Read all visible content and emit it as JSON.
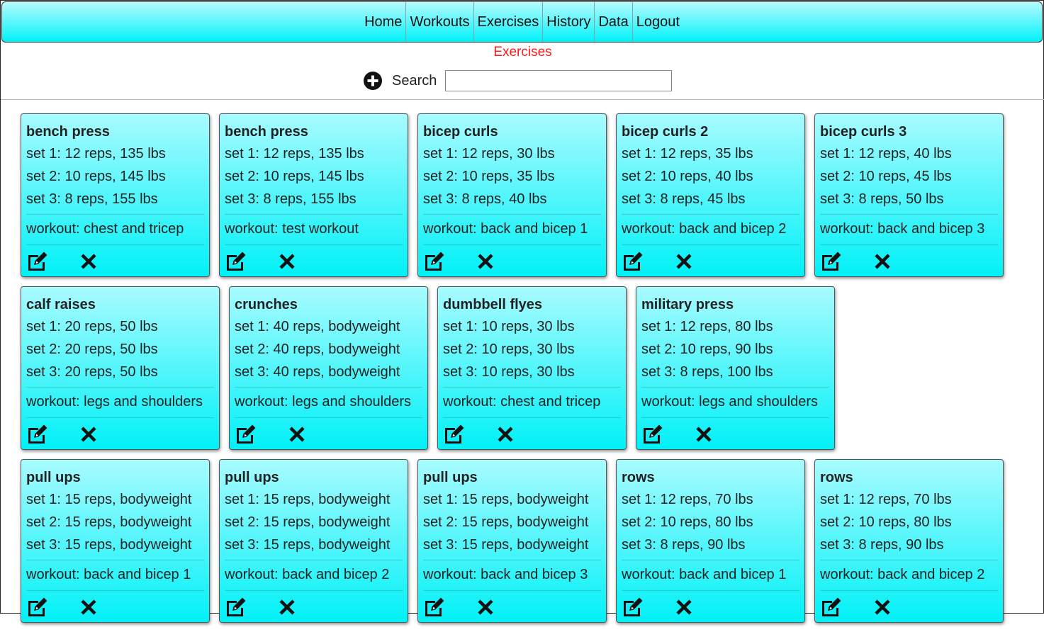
{
  "nav": {
    "items": [
      {
        "label": "Home"
      },
      {
        "label": "Workouts"
      },
      {
        "label": "Exercises"
      },
      {
        "label": "History"
      },
      {
        "label": "Data"
      },
      {
        "label": "Logout"
      }
    ]
  },
  "page": {
    "title": "Exercises"
  },
  "search": {
    "label": "Search",
    "value": "",
    "placeholder": ""
  },
  "colors": {
    "title": "#ff1a1a",
    "card_top": "#a8fbff",
    "card_bottom": "#00f1f7"
  },
  "icons": {
    "add": "plus-circle-icon",
    "edit": "edit-icon",
    "delete": "close-icon"
  },
  "cards": [
    {
      "name": "bench press",
      "sets": [
        "set 1: 12 reps, 135 lbs",
        "set 2: 10 reps, 145 lbs",
        "set 3: 8 reps, 155 lbs"
      ],
      "workout": "workout: chest and tricep"
    },
    {
      "name": "bench press",
      "sets": [
        "set 1: 12 reps, 135 lbs",
        "set 2: 10 reps, 145 lbs",
        "set 3: 8 reps, 155 lbs"
      ],
      "workout": "workout: test workout"
    },
    {
      "name": "bicep curls",
      "sets": [
        "set 1: 12 reps, 30 lbs",
        "set 2: 10 reps, 35 lbs",
        "set 3: 8 reps, 40 lbs"
      ],
      "workout": "workout: back and bicep 1"
    },
    {
      "name": "bicep curls 2",
      "sets": [
        "set 1: 12 reps, 35 lbs",
        "set 2: 10 reps, 40 lbs",
        "set 3: 8 reps, 45 lbs"
      ],
      "workout": "workout: back and bicep 2"
    },
    {
      "name": "bicep curls 3",
      "sets": [
        "set 1: 12 reps, 40 lbs",
        "set 2: 10 reps, 45 lbs",
        "set 3: 8 reps, 50 lbs"
      ],
      "workout": "workout: back and bicep 3"
    },
    {
      "name": "calf raises",
      "sets": [
        "set 1: 20 reps, 50 lbs",
        "set 2: 20 reps, 50 lbs",
        "set 3: 20 reps, 50 lbs"
      ],
      "workout": "workout: legs and shoulders"
    },
    {
      "name": "crunches",
      "sets": [
        "set 1: 40 reps, bodyweight",
        "set 2: 40 reps, bodyweight",
        "set 3: 40 reps, bodyweight"
      ],
      "workout": "workout: legs and shoulders"
    },
    {
      "name": "dumbbell flyes",
      "sets": [
        "set 1: 10 reps, 30 lbs",
        "set 2: 10 reps, 30 lbs",
        "set 3: 10 reps, 30 lbs"
      ],
      "workout": "workout: chest and tricep"
    },
    {
      "name": "military press",
      "sets": [
        "set 1: 12 reps, 80 lbs",
        "set 2: 10 reps, 90 lbs",
        "set 3: 8 reps, 100 lbs"
      ],
      "workout": "workout: legs and shoulders"
    },
    {
      "name": "pull ups",
      "sets": [
        "set 1: 15 reps, bodyweight",
        "set 2: 15 reps, bodyweight",
        "set 3: 15 reps, bodyweight"
      ],
      "workout": "workout: back and bicep 1"
    },
    {
      "name": "pull ups",
      "sets": [
        "set 1: 15 reps, bodyweight",
        "set 2: 15 reps, bodyweight",
        "set 3: 15 reps, bodyweight"
      ],
      "workout": "workout: back and bicep 2"
    },
    {
      "name": "pull ups",
      "sets": [
        "set 1: 15 reps, bodyweight",
        "set 2: 15 reps, bodyweight",
        "set 3: 15 reps, bodyweight"
      ],
      "workout": "workout: back and bicep 3"
    },
    {
      "name": "rows",
      "sets": [
        "set 1: 12 reps, 70 lbs",
        "set 2: 10 reps, 80 lbs",
        "set 3: 8 reps, 90 lbs"
      ],
      "workout": "workout: back and bicep 1"
    },
    {
      "name": "rows",
      "sets": [
        "set 1: 12 reps, 70 lbs",
        "set 2: 10 reps, 80 lbs",
        "set 3: 8 reps, 90 lbs"
      ],
      "workout": "workout: back and bicep 2"
    }
  ]
}
